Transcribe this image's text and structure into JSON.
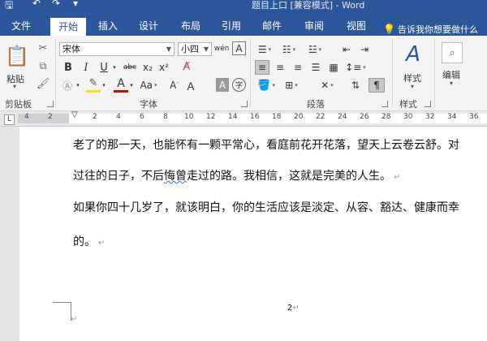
{
  "window": {
    "title": "题目上口 [兼容模式] - Word"
  },
  "ribbon_tabs": [
    {
      "label": "文件"
    },
    {
      "label": "开始"
    },
    {
      "label": "插入"
    },
    {
      "label": "设计"
    },
    {
      "label": "布局"
    },
    {
      "label": "引用"
    },
    {
      "label": "邮件"
    },
    {
      "label": "审阅"
    },
    {
      "label": "视图"
    }
  ],
  "tell_me": {
    "label": "告诉我你想要做什么"
  },
  "clipboard": {
    "paste_label": "粘贴",
    "group_label": "剪贴板"
  },
  "font": {
    "name": "宋体",
    "size": "小四",
    "group_label": "字体",
    "wen_label": "wén",
    "a_box_label": "A",
    "bold": "B",
    "italic": "I",
    "underline": "U",
    "strike": "abc",
    "subscript": "x₂",
    "superscript": "x²",
    "change_case": "Aa",
    "shrink": "A",
    "shade_a": "A",
    "circle": "字"
  },
  "paragraph": {
    "group_label": "段落"
  },
  "styles": {
    "label": "样式",
    "group_label": "样式"
  },
  "editing": {
    "label": "编辑"
  },
  "ruler": {
    "left_marks": [
      "4",
      "2"
    ],
    "marks": [
      "2",
      "4",
      "6",
      "8",
      "10",
      "12",
      "14",
      "16",
      "18",
      "20",
      "22",
      "24",
      "26",
      "28",
      "30",
      "32",
      "34",
      "36",
      "38",
      "40"
    ],
    "tab_stop": "L"
  },
  "document": {
    "paragraphs": [
      "老了的那一天，也能怀有一颗平常心，看庭前花开花落，望天上云卷云舒。对",
      "过往的日子，不后",
      "悔曾",
      "走过的路。我相信，这就是完美的人生。",
      "如果你四十几岁了，就该明白，你的生活应该是淡定、从容、豁达、健康而幸",
      "的。"
    ],
    "paragraph_mark": "↵",
    "page_number": "2"
  },
  "colors": {
    "accent": "#2b579a",
    "highlight": "#f6e400",
    "font_color": "#e00000"
  }
}
